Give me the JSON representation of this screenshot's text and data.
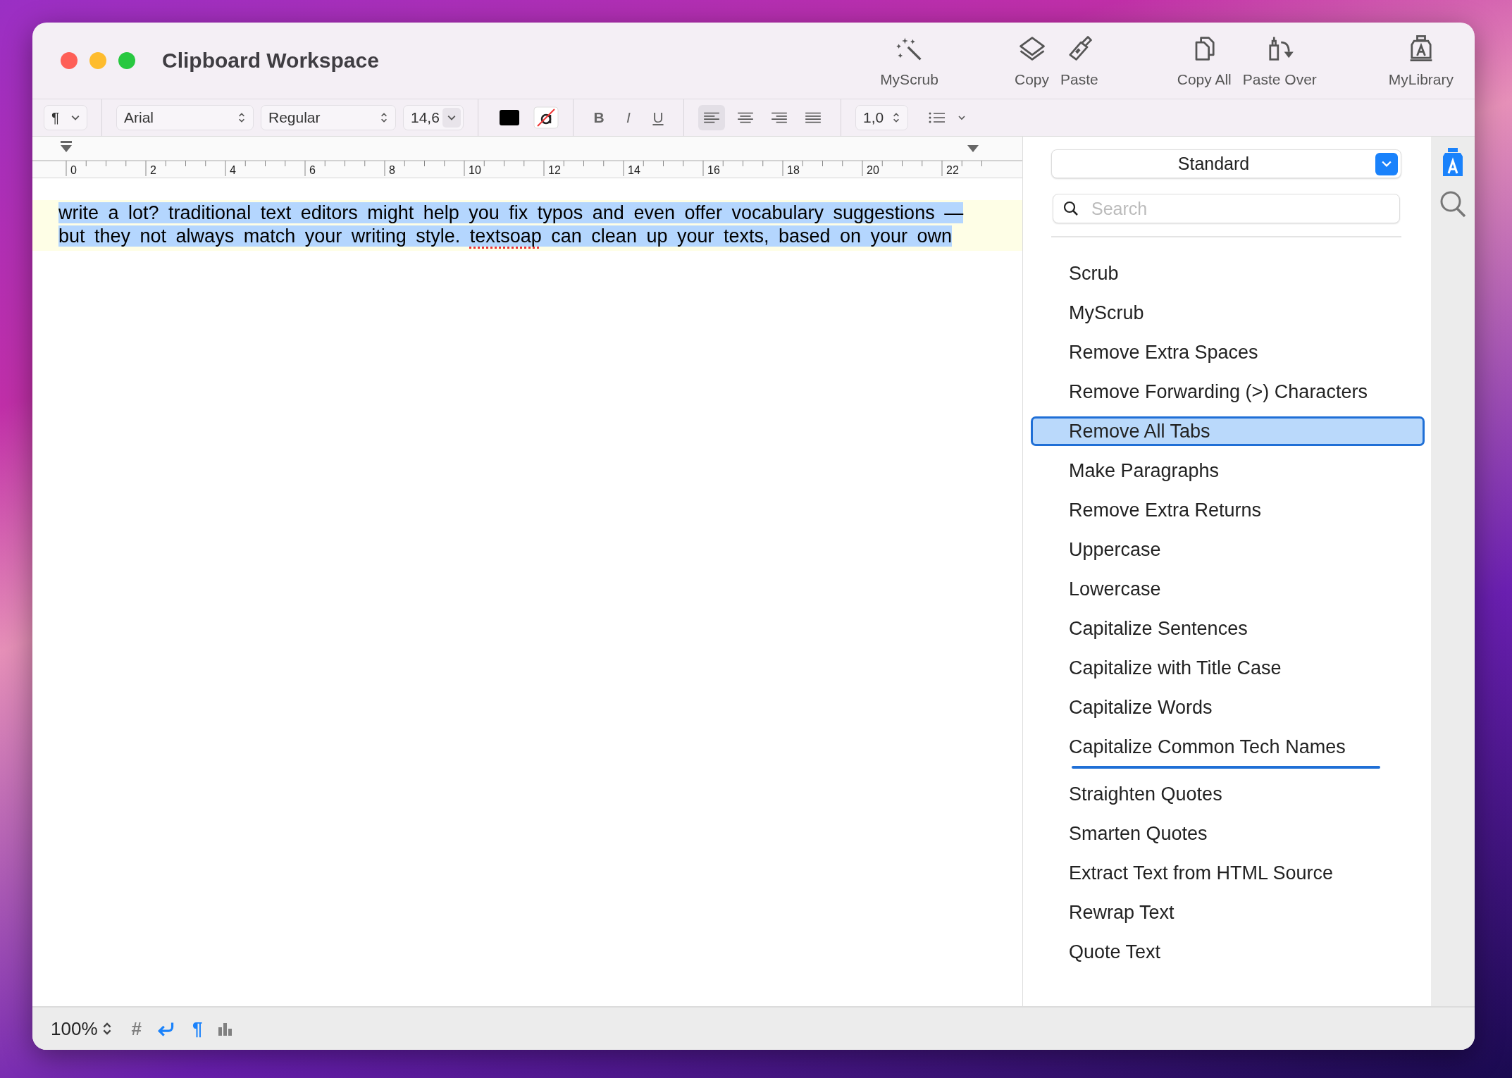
{
  "window": {
    "title": "Clipboard Workspace"
  },
  "toolbar": [
    {
      "label": "MyScrub"
    },
    {
      "label": "Copy"
    },
    {
      "label": "Paste"
    },
    {
      "label": "Copy All"
    },
    {
      "label": "Paste Over"
    },
    {
      "label": "MyLibrary"
    }
  ],
  "format_bar": {
    "paragraph": "¶",
    "font": "Arial",
    "style": "Regular",
    "size": "14,6",
    "bold": "B",
    "italic": "I",
    "underline": "U",
    "alignments": [
      {
        "selected": true
      },
      {
        "selected": false
      },
      {
        "selected": false
      },
      {
        "selected": false
      }
    ],
    "line_spacing": "1,0"
  },
  "ruler": {
    "labels": [
      "0",
      "2",
      "4",
      "6",
      "8",
      "10",
      "12",
      "14",
      "16",
      "18",
      "20",
      "22"
    ]
  },
  "document": {
    "selected": true,
    "lines": [
      [
        {
          "text": "write a lot? traditional text editors might help you fix typos and even offer vocabulary suggestions —",
          "misspelled": false
        }
      ],
      [
        {
          "text": "but they not always match your writing style. ",
          "misspelled": false
        },
        {
          "text": "textsoap",
          "misspelled": true
        },
        {
          "text": " can clean up your texts, based on your own",
          "misspelled": false
        }
      ]
    ]
  },
  "sidebar": {
    "set": "Standard",
    "search": {
      "placeholder": "Search"
    },
    "items": [
      {
        "label": "Scrub",
        "selected": false,
        "drop_target": false
      },
      {
        "label": "MyScrub",
        "selected": false,
        "drop_target": false
      },
      {
        "label": "Remove Extra Spaces",
        "selected": false,
        "drop_target": false
      },
      {
        "label": "Remove Forwarding (>) Characters",
        "selected": false,
        "drop_target": false
      },
      {
        "label": "Remove All Tabs",
        "selected": true,
        "drop_target": false
      },
      {
        "label": "Make Paragraphs",
        "selected": false,
        "drop_target": false
      },
      {
        "label": "Remove Extra Returns",
        "selected": false,
        "drop_target": false
      },
      {
        "label": "Uppercase",
        "selected": false,
        "drop_target": false
      },
      {
        "label": "Lowercase",
        "selected": false,
        "drop_target": false
      },
      {
        "label": "Capitalize Sentences",
        "selected": false,
        "drop_target": false
      },
      {
        "label": "Capitalize with Title Case",
        "selected": false,
        "drop_target": false
      },
      {
        "label": "Capitalize Words",
        "selected": false,
        "drop_target": false
      },
      {
        "label": "Capitalize Common Tech Names",
        "selected": false,
        "drop_target": true
      },
      {
        "label": "Straighten Quotes",
        "selected": false,
        "drop_target": false
      },
      {
        "label": "Smarten Quotes",
        "selected": false,
        "drop_target": false
      },
      {
        "label": "Extract Text from HTML Source",
        "selected": false,
        "drop_target": false
      },
      {
        "label": "Rewrap Text",
        "selected": false,
        "drop_target": false
      },
      {
        "label": "Quote Text",
        "selected": false,
        "drop_target": false
      }
    ],
    "strip_tabs": [
      {
        "selected": true
      },
      {
        "selected": false
      }
    ]
  },
  "status_bar": {
    "zoom": "100%",
    "line_numbers": {
      "label": "#",
      "on": false
    },
    "wrap_on": true,
    "invisibles": {
      "label": "¶",
      "on": true
    }
  }
}
